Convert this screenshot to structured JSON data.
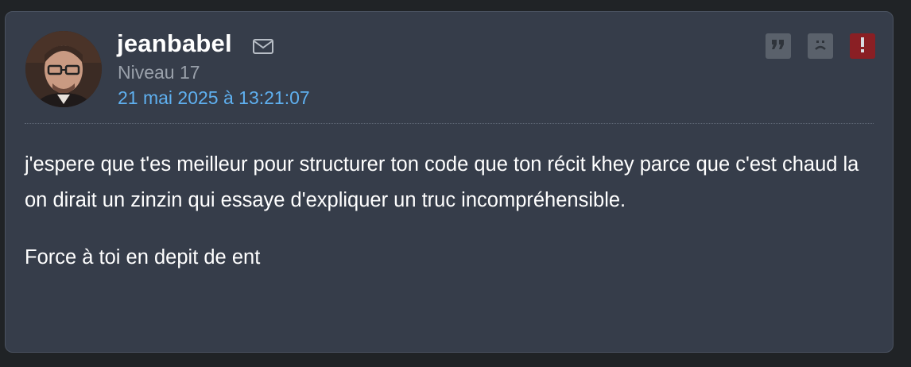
{
  "post": {
    "author": "jeanbabel",
    "level": "Niveau 17",
    "date": "21 mai 2025 à 13:21:07",
    "paragraphs": [
      "j'espere que t'es meilleur pour structurer ton code que ton récit khey parce que c'est chaud la on dirait un zinzin qui essaye d'expliquer un truc incompréhensible.",
      "Force à toi en depit de ent"
    ],
    "icons": {
      "message": "envelope-icon",
      "quote": "quote-icon",
      "blacklist": "sad-face-icon",
      "report": "exclamation-icon"
    }
  },
  "colors": {
    "background": "#363d4a",
    "date": "#5fb0f0",
    "level": "#9aa1ab",
    "report": "#8a1f24"
  }
}
